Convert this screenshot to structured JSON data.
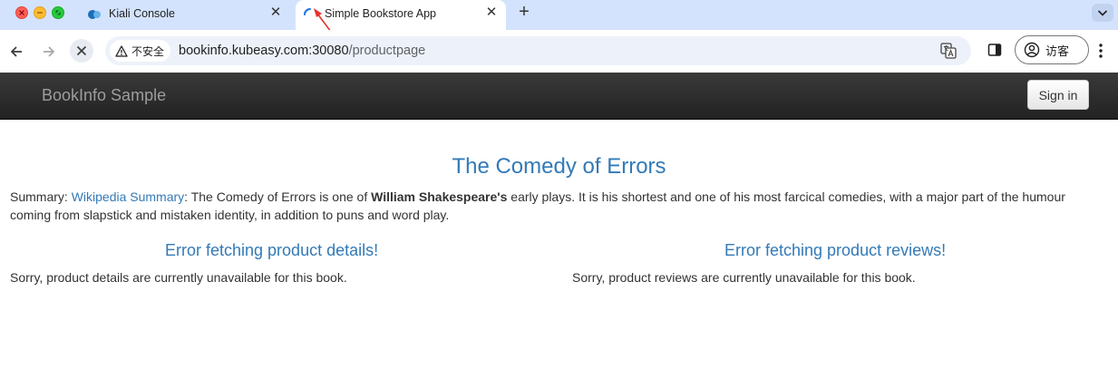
{
  "browser": {
    "tabs": [
      {
        "title": "Kiali Console",
        "icon": "kiali-icon",
        "active": false
      },
      {
        "title": "Simple Bookstore App",
        "icon": "loading-spinner-icon",
        "active": true
      }
    ],
    "address": {
      "security_label": "不安全",
      "url_host": "bookinfo.kubeasy.com:30080",
      "url_path": "/productpage"
    },
    "profile_label": "访客"
  },
  "navbar": {
    "brand": "BookInfo Sample",
    "signin_label": "Sign in"
  },
  "product": {
    "title": "The Comedy of Errors",
    "summary_prefix": "Summary: ",
    "summary_link": "Wikipedia Summary",
    "summary_text_1": ": The Comedy of Errors is one of ",
    "summary_bold": "William Shakespeare's",
    "summary_text_2": " early plays. It is his shortest and one of his most farcical comedies, with a major part of the humour coming from slapstick and mistaken identity, in addition to puns and word play."
  },
  "details": {
    "heading": "Error fetching product details!",
    "message": "Sorry, product details are currently unavailable for this book."
  },
  "reviews": {
    "heading": "Error fetching product reviews!",
    "message": "Sorry, product reviews are currently unavailable for this book."
  },
  "colors": {
    "link_blue": "#337ab7",
    "navbar_dark": "#222222",
    "tabstrip": "#d3e3fd"
  }
}
